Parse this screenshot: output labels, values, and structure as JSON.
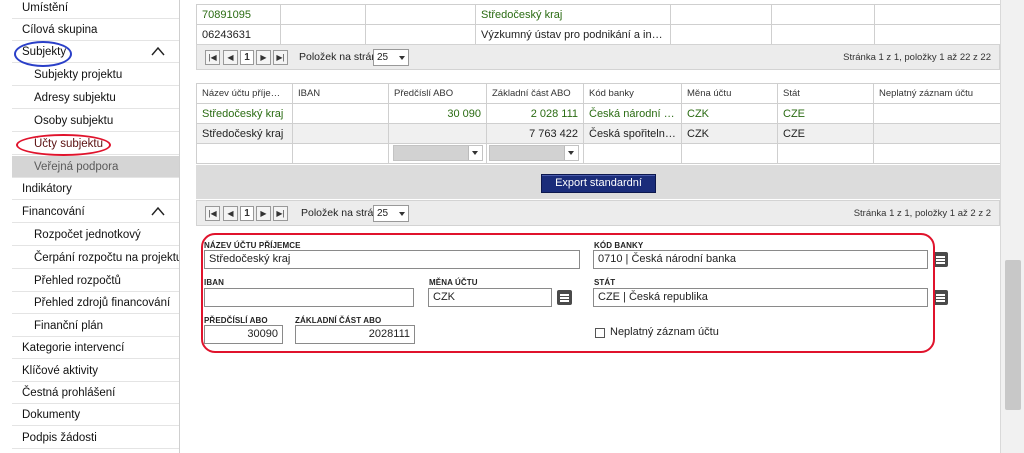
{
  "sidebar": {
    "items": [
      {
        "label": "Umístění",
        "level": "top"
      },
      {
        "label": "Cílová skupina",
        "level": "top"
      },
      {
        "label": "Subjekty",
        "level": "top",
        "expanded": true
      },
      {
        "label": "Subjekty projektu",
        "level": "sub"
      },
      {
        "label": "Adresy subjektu",
        "level": "sub"
      },
      {
        "label": "Osoby subjektu",
        "level": "sub"
      },
      {
        "label": "Účty subjektu",
        "level": "sub"
      },
      {
        "label": "Veřejná podpora",
        "level": "sub",
        "active": true
      },
      {
        "label": "Indikátory",
        "level": "top"
      },
      {
        "label": "Financování",
        "level": "top",
        "expanded": true
      },
      {
        "label": "Rozpočet jednotkový",
        "level": "sub"
      },
      {
        "label": "Čerpání rozpočtu na projektu",
        "level": "sub"
      },
      {
        "label": "Přehled rozpočtů",
        "level": "sub"
      },
      {
        "label": "Přehled zdrojů financování",
        "level": "sub"
      },
      {
        "label": "Finanční plán",
        "level": "sub"
      },
      {
        "label": "Kategorie intervencí",
        "level": "top"
      },
      {
        "label": "Klíčové aktivity",
        "level": "top"
      },
      {
        "label": "Čestná prohlášení",
        "level": "top"
      },
      {
        "label": "Dokumenty",
        "level": "top"
      },
      {
        "label": "Podpis žádosti",
        "level": "top"
      }
    ]
  },
  "top_table": {
    "rows": [
      {
        "c1": "70891095",
        "c2": "",
        "c3": "",
        "c4": "Středočeský kraj",
        "c5": "",
        "c6": "",
        "c7": ""
      },
      {
        "c1": "06243631",
        "c2": "",
        "c3": "",
        "c4": "Výzkumný ústav pro podnikání a inovace, z.ú.",
        "c5": "",
        "c6": "",
        "c7": ""
      }
    ]
  },
  "pager1": {
    "page": "1",
    "items_label": "Položek na stránku",
    "items_value": "25",
    "info": "Stránka 1 z 1, položky 1 až 22 z 22"
  },
  "accounts_table": {
    "headers": [
      "Název účtu příjemce",
      "IBAN",
      "Předčíslí ABO",
      "Základní část ABO",
      "Kód banky",
      "Měna účtu",
      "Stát",
      "Neplatný záznam účtu"
    ],
    "rows": [
      [
        "Středočeský kraj",
        "",
        "30 090",
        "2 028 111",
        "Česká národní banka",
        "CZK",
        "CZE",
        ""
      ],
      [
        "Středočeský kraj",
        "",
        "",
        "7 763 422",
        "Česká spořitelna, a...",
        "CZK",
        "CZE",
        ""
      ]
    ]
  },
  "export_button": "Export standardní",
  "pager2": {
    "page": "1",
    "items_label": "Položek na stránku",
    "items_value": "25",
    "info": "Stránka 1 z 1, položky 1 až 2 z 2"
  },
  "form": {
    "account_name_label": "NÁZEV ÚČTU PŘÍJEMCE",
    "account_name_value": "Středočeský kraj",
    "bank_code_label": "KÓD BANKY",
    "bank_code_value": "0710 | Česká národní banka",
    "iban_label": "IBAN",
    "iban_value": "",
    "currency_label": "MĚNA ÚČTU",
    "currency_value": "CZK",
    "state_label": "STÁT",
    "state_value": "CZE | Česká republika",
    "prefix_label": "PŘEDČÍSLÍ ABO",
    "prefix_value": "30090",
    "base_label": "ZÁKLADNÍ ČÁST ABO",
    "base_value": "2028111",
    "invalid_label": "Neplatný záznam účtu",
    "invalid_checked": false
  },
  "colors": {
    "highlight_red": "#e0132c",
    "highlight_blue": "#2a3fc8",
    "green_text": "#2a6b12",
    "export_bg": "#1a2c7a"
  }
}
